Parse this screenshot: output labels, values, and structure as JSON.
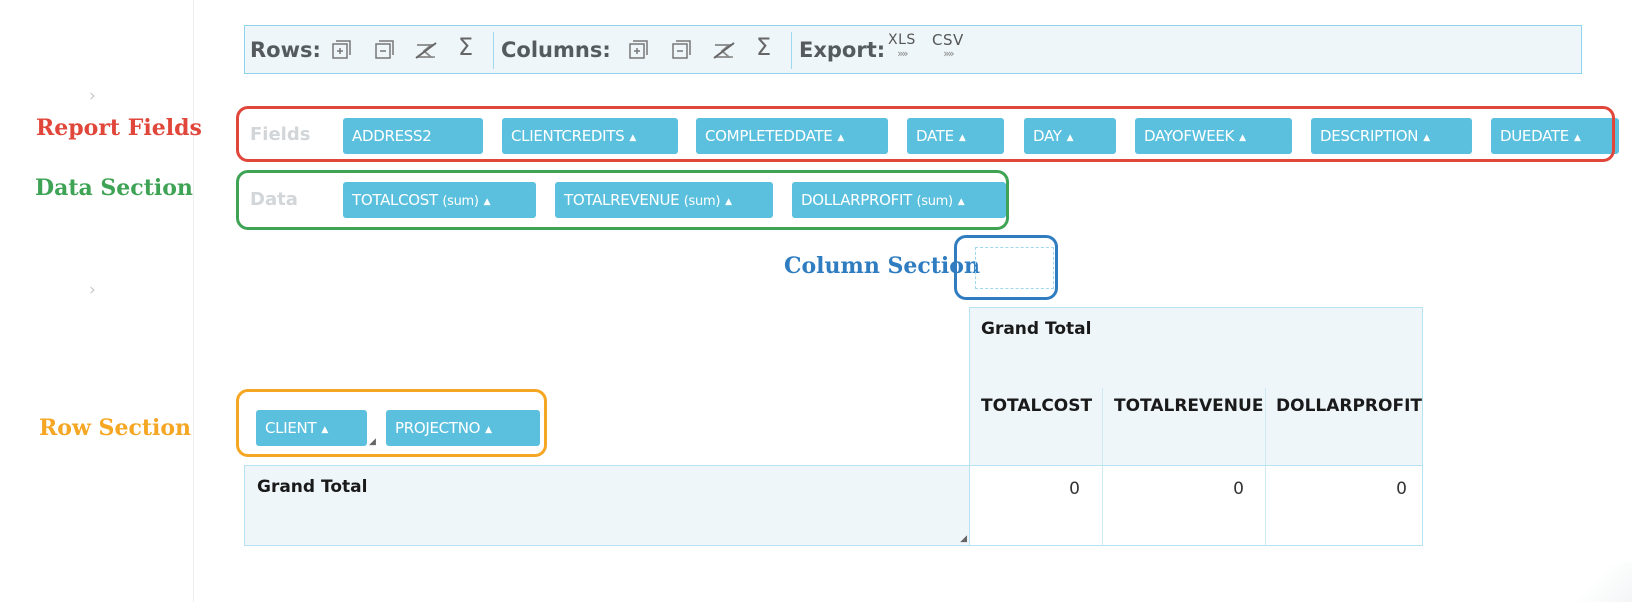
{
  "colors": {
    "accent": "#5bc0de",
    "report_fields_highlight": "#e0463a",
    "data_section_highlight": "#3fa356",
    "column_section_highlight": "#2f7dc0",
    "row_section_highlight": "#f5a623"
  },
  "annotations": {
    "report_fields": "Report Fields",
    "data_section": "Data Section",
    "column_section": "Column Section",
    "row_section": "Row Section"
  },
  "toolbar": {
    "rows_label": "Rows:",
    "columns_label": "Columns:",
    "export_label": "Export:",
    "sigma": "Σ",
    "export_xls": "XLS",
    "export_csv": "CSV",
    "export_arrows": "»»",
    "icons": [
      "expand-all-icon",
      "collapse-all-icon",
      "toggle-subtotals-icon",
      "sigma-icon"
    ]
  },
  "fields": {
    "label": "Fields",
    "items": [
      "ADDRESS2",
      "CLIENTCREDITS",
      "COMPLETEDDATE",
      "DATE",
      "DAY",
      "DAYOFWEEK",
      "DESCRIPTION",
      "DUEDATE"
    ]
  },
  "data": {
    "label": "Data",
    "items": [
      {
        "name": "TOTALCOST",
        "agg": "(sum)"
      },
      {
        "name": "TOTALREVENUE",
        "agg": "(sum)"
      },
      {
        "name": "DOLLARPROFIT",
        "agg": "(sum)"
      }
    ]
  },
  "rows": {
    "items": [
      "CLIENT",
      "PROJECTNO"
    ]
  },
  "sort_glyph": "▲",
  "pivot": {
    "column_header": "Grand Total",
    "measure_headers": [
      "TOTALCOST",
      "TOTALREVENUE",
      "DOLLARPROFIT"
    ],
    "row_header": "Grand Total",
    "values": [
      "0",
      "0",
      "0"
    ]
  }
}
